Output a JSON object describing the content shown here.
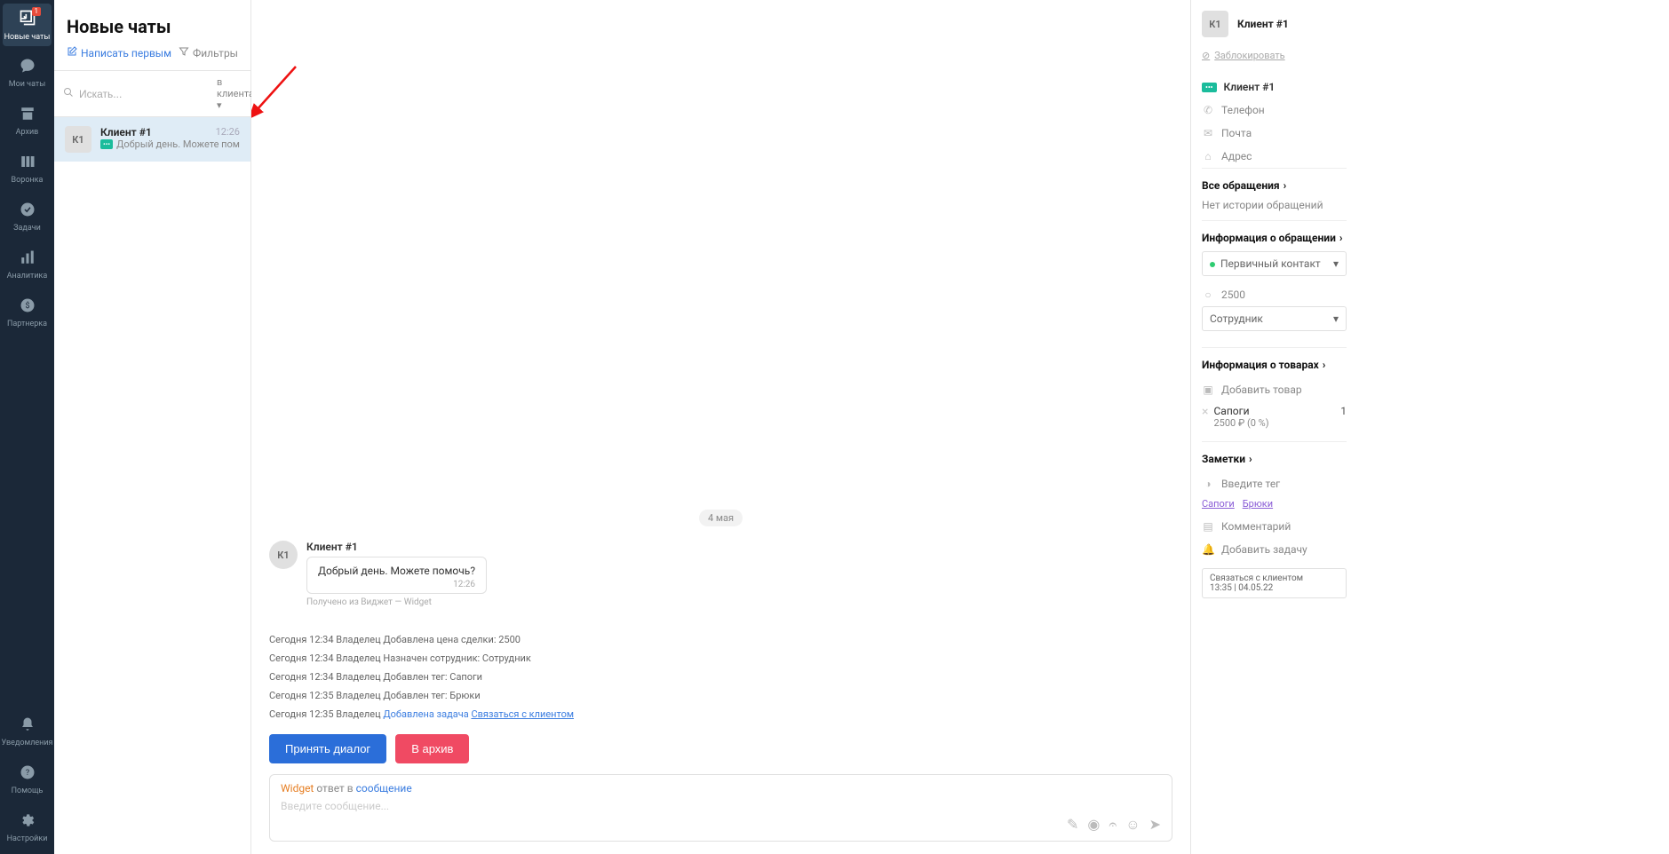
{
  "nav": {
    "items": [
      {
        "label": "Новые чаты",
        "badge": "1"
      },
      {
        "label": "Мои чаты"
      },
      {
        "label": "Архив"
      },
      {
        "label": "Воронка"
      },
      {
        "label": "Задачи"
      },
      {
        "label": "Аналитика"
      },
      {
        "label": "Партнерка"
      }
    ],
    "bottom": [
      {
        "label": "Уведомления"
      },
      {
        "label": "Помощь"
      },
      {
        "label": "Настройки"
      }
    ]
  },
  "chatlist": {
    "title": "Новые чаты",
    "write_first": "Написать первым",
    "filters": "Фильтры",
    "search_placeholder": "Искать...",
    "search_scope": "в клиентах",
    "item": {
      "avatar": "К1",
      "name": "Клиент #1",
      "time": "12:26",
      "preview": "Добрый день. Можете пом..."
    }
  },
  "convo": {
    "date": "4 мая",
    "msg": {
      "avatar": "К1",
      "author": "Клиент #1",
      "text": "Добрый день. Можете помочь?",
      "time": "12:26",
      "meta": "Получено из Виджет — Widget"
    },
    "logs": [
      {
        "t": "Сегодня 12:34",
        "w": "Владелец",
        "a": "Добавлена цена сделки:",
        "v": "2500"
      },
      {
        "t": "Сегодня 12:34",
        "w": "Владелец",
        "a": "Назначен сотрудник:",
        "v": "Сотрудник"
      },
      {
        "t": "Сегодня 12:34",
        "w": "Владелец",
        "a": "Добавлен тег:",
        "v": "Сапоги"
      },
      {
        "t": "Сегодня 12:35",
        "w": "Владелец",
        "a": "Добавлен тег:",
        "v": "Брюки"
      },
      {
        "t": "Сегодня 12:35",
        "w": "Владелец",
        "a": "Добавлена задача",
        "link": "Связаться с клиентом"
      }
    ],
    "btn_accept": "Принять диалог",
    "btn_archive": "В архив",
    "input_widget": "Widget",
    "input_answer": "ответ в",
    "input_msg": "сообщение",
    "input_placeholder": "Введите сообщение..."
  },
  "rpanel": {
    "avatar": "К1",
    "client_name": "Клиент #1",
    "block": "Заблокировать",
    "contact_name": "Клиент #1",
    "phone": "Телефон",
    "email": "Почта",
    "address": "Адрес",
    "requests_title": "Все обращения",
    "requests_empty": "Нет истории обращений",
    "info_title": "Информация о обращении",
    "stage": "Первичный контакт",
    "amount": "2500",
    "assignee": "Сотрудник",
    "products_title": "Информация о товарах",
    "add_product": "Добавить товар",
    "product_name": "Сапоги",
    "product_price": "2500 ₽ (0 %)",
    "product_qty": "1",
    "notes_title": "Заметки",
    "enter_tag": "Введите тег",
    "tag1": "Сапоги",
    "tag2": "Брюки",
    "comment": "Комментарий",
    "add_task": "Добавить задачу",
    "task_text": "Связаться с клиентом",
    "task_time": "13:35 | 04.05.22"
  }
}
